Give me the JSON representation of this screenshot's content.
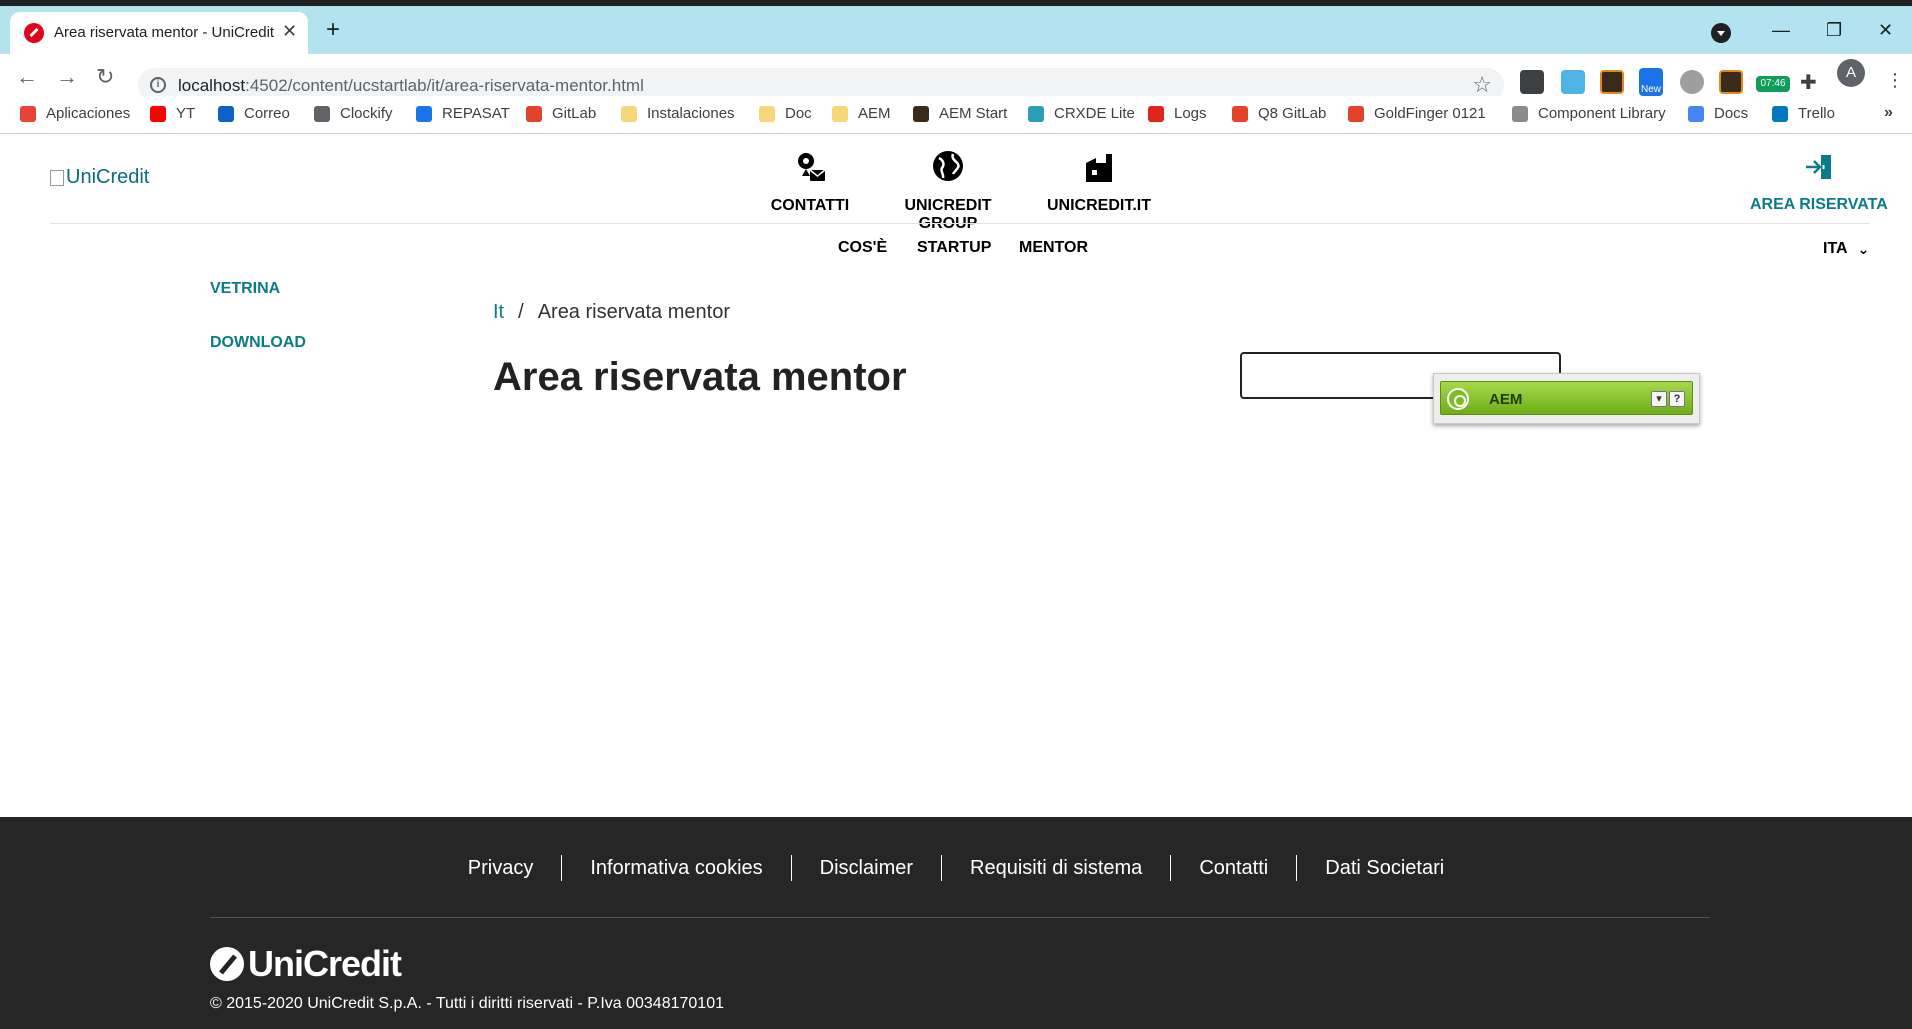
{
  "browser": {
    "tab_title": "Area riservata mentor - UniCredit",
    "tab_close": "✕",
    "new_tab": "+",
    "url_host": "localhost",
    "url_rest": ":4502/content/ucstartlab/it/area-riservata-mentor.html",
    "ext_clock": "07:46",
    "ext_new": "New",
    "profile_initial": "A",
    "bookmarks": [
      {
        "label": "Aplicaciones",
        "icon": "apps-grid-icon",
        "color": "#ea4335"
      },
      {
        "label": "YT",
        "icon": "youtube-icon",
        "color": "#ff0000"
      },
      {
        "label": "Correo",
        "icon": "outlook-icon",
        "color": "#0a64c8"
      },
      {
        "label": "Clockify",
        "icon": "clockify-icon",
        "color": "#5f6368"
      },
      {
        "label": "REPASAT",
        "icon": "repasat-icon",
        "color": "#1a73e8"
      },
      {
        "label": "GitLab",
        "icon": "gitlab-icon",
        "color": "#e24329"
      },
      {
        "label": "Instalaciones",
        "icon": "folder-icon",
        "color": "#f6d77a"
      },
      {
        "label": "Doc",
        "icon": "folder-icon",
        "color": "#f6d77a"
      },
      {
        "label": "AEM",
        "icon": "folder-icon",
        "color": "#f6d77a"
      },
      {
        "label": "AEM Start",
        "icon": "aem-start-icon",
        "color": "#3a2a1a"
      },
      {
        "label": "CRXDE Lite",
        "icon": "crxde-icon",
        "color": "#2a9fb7"
      },
      {
        "label": "Logs",
        "icon": "adobe-icon",
        "color": "#e1251b"
      },
      {
        "label": "Q8 GitLab",
        "icon": "gitlab-icon",
        "color": "#e24329"
      },
      {
        "label": "GoldFinger 0121",
        "icon": "gitlab-icon",
        "color": "#e24329"
      },
      {
        "label": "Component Library",
        "icon": "component-library-icon",
        "color": "#8a8a8a"
      },
      {
        "label": "Docs",
        "icon": "docs-icon",
        "color": "#4285f4"
      },
      {
        "label": "Trello",
        "icon": "trello-icon",
        "color": "#0079bf"
      }
    ],
    "bookmarks_more": "»"
  },
  "header": {
    "logo_alt": "UniCredit",
    "nav": [
      {
        "label": "CONTATTI",
        "icon": "contact-icon"
      },
      {
        "label": "UNICREDIT GROUP",
        "icon": "globe-icon"
      },
      {
        "label": "UNICREDIT.IT",
        "icon": "building-icon"
      }
    ],
    "area_riservata": "AREA RISERVATA",
    "subnav": [
      "COS'È",
      "STARTUP",
      "MENTOR"
    ],
    "lang": "ITA"
  },
  "sidebar": {
    "links": [
      "VETRINA",
      "DOWNLOAD"
    ]
  },
  "main": {
    "breadcrumb_link": "It",
    "breadcrumb_sep": "/",
    "breadcrumb_current": "Area riservata mentor",
    "title": "Area riservata mentor"
  },
  "aem_widget": {
    "label": "AEM",
    "help": "?",
    "dropdown": "▾"
  },
  "footer": {
    "links": [
      "Privacy",
      "Informativa cookies",
      "Disclaimer",
      "Requisiti di sistema",
      "Contatti",
      "Dati Societari"
    ],
    "logo_text": "UniCredit",
    "copyright": "© 2015-2020 UniCredit S.p.A. - Tutti i diritti riservati - P.Iva 00348170101"
  },
  "colors": {
    "brand_teal": "#0a7c89",
    "brand_red": "#e2001a",
    "footer_bg": "#262626",
    "tabstrip_bg": "#b2e3ee",
    "aem_green": "#7bbd22"
  }
}
